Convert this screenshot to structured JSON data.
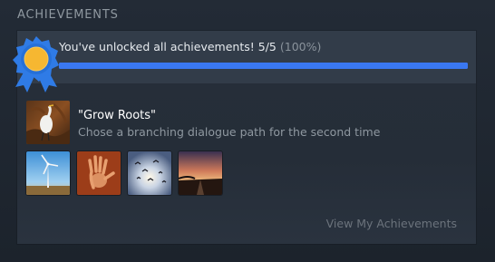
{
  "section": {
    "title": "ACHIEVEMENTS"
  },
  "summary": {
    "text": "You've unlocked all achievements! 5/5",
    "percent_text": "(100%)",
    "unlocked": 5,
    "total": 5,
    "progress_fraction": 1.0,
    "progress_color": "#3a78f2"
  },
  "featured": {
    "icon": "white-egret-icon",
    "title": "\"Grow Roots\"",
    "description": "Chose a branching dialogue path for the second time"
  },
  "unlocked_thumbnails": [
    {
      "icon": "wind-turbine-icon"
    },
    {
      "icon": "handprint-icon"
    },
    {
      "icon": "birds-at-sunset-icon"
    },
    {
      "icon": "road-at-dusk-icon"
    }
  ],
  "footer": {
    "link_label": "View My Achievements"
  },
  "colors": {
    "background": "#1f2731",
    "panel": "#262f3a",
    "summary_bar": "#323c49",
    "medal_blue": "#2f7be6",
    "medal_gold": "#f6b731"
  }
}
